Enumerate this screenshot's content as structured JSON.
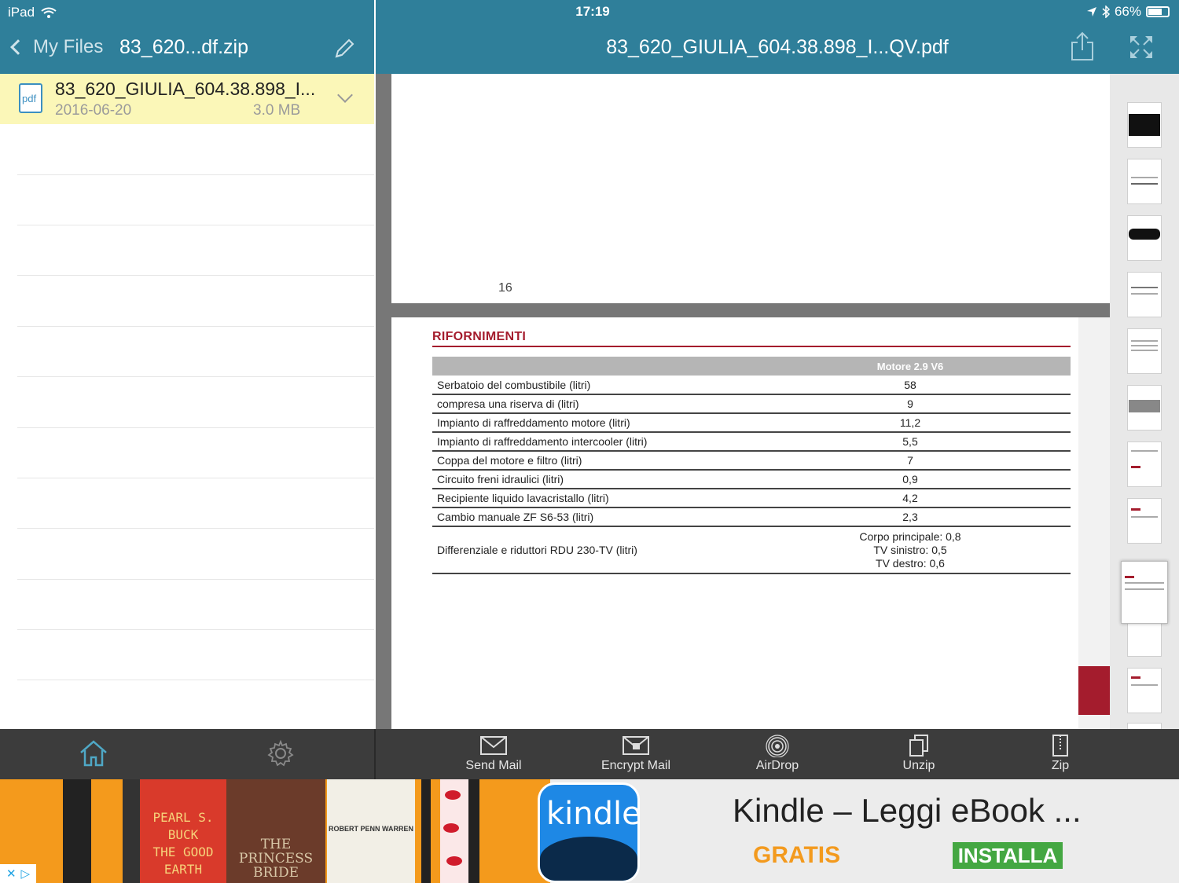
{
  "status": {
    "device": "iPad",
    "time": "17:19",
    "battery": "66%"
  },
  "left_header": {
    "back_label": "My Files",
    "title": "83_620...df.zip"
  },
  "file_list": [
    {
      "name": "83_620_GIULIA_604.38.898_I...",
      "date": "2016-06-20",
      "size": "3.0 MB",
      "icon_text": "pdf"
    }
  ],
  "viewer_header": {
    "title": "83_620_GIULIA_604.38.898_I...QV.pdf"
  },
  "document": {
    "prev_page_number": "16",
    "section_title": "RIFORNIMENTI",
    "table_header": {
      "col1": "",
      "col2": "Motore 2.9 V6"
    },
    "rows": [
      {
        "label": "Serbatoio del combustibile (litri)",
        "value": "58"
      },
      {
        "label": "compresa una riserva di (litri)",
        "value": "9"
      },
      {
        "label": "Impianto di raffreddamento motore (litri)",
        "value": "11,2"
      },
      {
        "label": "Impianto di raffreddamento intercooler (litri)",
        "value": "5,5"
      },
      {
        "label": "Coppa del motore e filtro (litri)",
        "value": "7"
      },
      {
        "label": "Circuito freni idraulici (litri)",
        "value": "0,9"
      },
      {
        "label": "Recipiente liquido lavacristallo (litri)",
        "value": "4,2"
      },
      {
        "label": "Cambio manuale ZF S6-53 (litri)",
        "value": "2,3"
      }
    ],
    "last_row": {
      "label": "Differenziale e riduttori RDU 230-TV (litri)",
      "line1": "Corpo principale: 0,8",
      "line2": "TV sinistro: 0,5",
      "line3": "TV destro: 0,6"
    }
  },
  "toolbar": {
    "send_mail": "Send Mail",
    "encrypt_mail": "Encrypt Mail",
    "airdrop": "AirDrop",
    "unzip": "Unzip",
    "zip": "Zip"
  },
  "ad": {
    "logo_text": "kindle",
    "title": "Kindle – Leggi eBook ...",
    "free_label": "GRATIS",
    "install_label": "INSTALLA",
    "book1_author": "PEARL S. BUCK",
    "book1_title": "THE GOOD EARTH",
    "book2_title": "THE PRINCESS BRIDE",
    "book3_author": "ROBERT PENN WARREN"
  },
  "colors": {
    "header_teal": "#2f7f9a",
    "selected_row": "#fbf7b8",
    "doc_red": "#a41c2d",
    "toolbar": "#3c3c3c",
    "ad_orange": "#f39a1e",
    "ad_green": "#44a742"
  }
}
